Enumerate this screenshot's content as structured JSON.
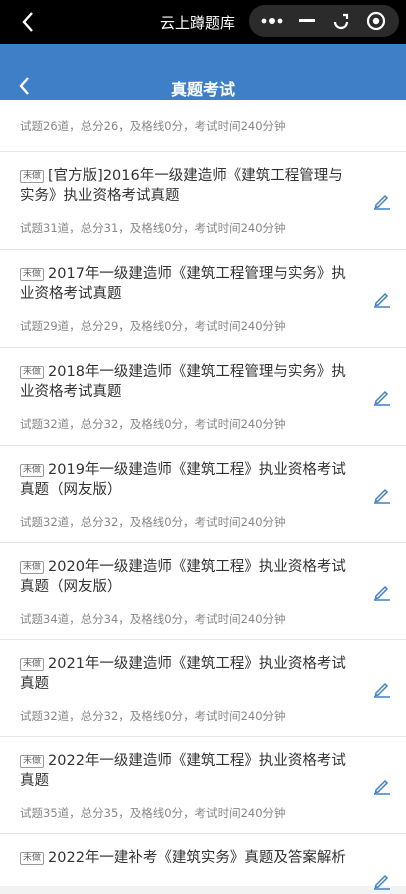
{
  "topbar": {
    "title": "云上蹲题库"
  },
  "header": {
    "title": "真题考试"
  },
  "badge_label": "未做",
  "items": [
    {
      "name": "",
      "meta": "试题26道，总分26，及格线0分，考试时间240分钟"
    },
    {
      "name": "[官方版]2016年一级建造师《建筑工程管理与实务》执业资格考试真题",
      "meta": "试题31道，总分31，及格线0分，考试时间240分钟"
    },
    {
      "name": "2017年一级建造师《建筑工程管理与实务》执业资格考试真题",
      "meta": "试题29道，总分29，及格线0分，考试时间240分钟"
    },
    {
      "name": "2018年一级建造师《建筑工程管理与实务》执业资格考试真题",
      "meta": "试题32道，总分32，及格线0分，考试时间240分钟"
    },
    {
      "name": "2019年一级建造师《建筑工程》执业资格考试真题（网友版）",
      "meta": "试题32道，总分32，及格线0分，考试时间240分钟"
    },
    {
      "name": "2020年一级建造师《建筑工程》执业资格考试真题（网友版）",
      "meta": "试题34道，总分34，及格线0分，考试时间240分钟"
    },
    {
      "name": "2021年一级建造师《建筑工程》执业资格考试真题",
      "meta": "试题32道，总分32，及格线0分，考试时间240分钟"
    },
    {
      "name": "2022年一级建造师《建筑工程》执业资格考试真题",
      "meta": "试题35道，总分35，及格线0分，考试时间240分钟"
    },
    {
      "name": "2022年一建补考《建筑实务》真题及答案解析",
      "meta": ""
    }
  ],
  "colors": {
    "accent": "#3f7fc7",
    "edit_icon": "#3f7fc7"
  }
}
